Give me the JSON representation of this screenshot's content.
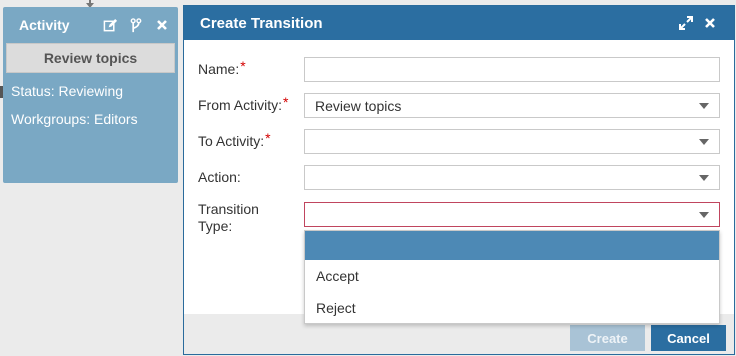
{
  "activity": {
    "header_label": "Activity",
    "name": "Review topics",
    "status": "Status: Reviewing",
    "workgroups": "Workgroups: Editors"
  },
  "modal": {
    "title": "Create Transition",
    "fields": {
      "name": {
        "label": "Name:",
        "value": ""
      },
      "from_activity": {
        "label": "From Activity:",
        "value": "Review topics"
      },
      "to_activity": {
        "label": "To Activity:",
        "value": ""
      },
      "action": {
        "label": "Action:",
        "value": ""
      },
      "transition_type": {
        "label": "Transition Type:",
        "value": ""
      }
    },
    "required_mark": "*",
    "transition_type_options": [
      "",
      "Accept",
      "Reject"
    ],
    "buttons": {
      "create": "Create",
      "cancel": "Cancel"
    }
  },
  "colors": {
    "header_blue": "#2b6ea1",
    "activity_card": "#7aa8c4",
    "selected_option": "#4d89b5",
    "required_red": "#d40000"
  }
}
